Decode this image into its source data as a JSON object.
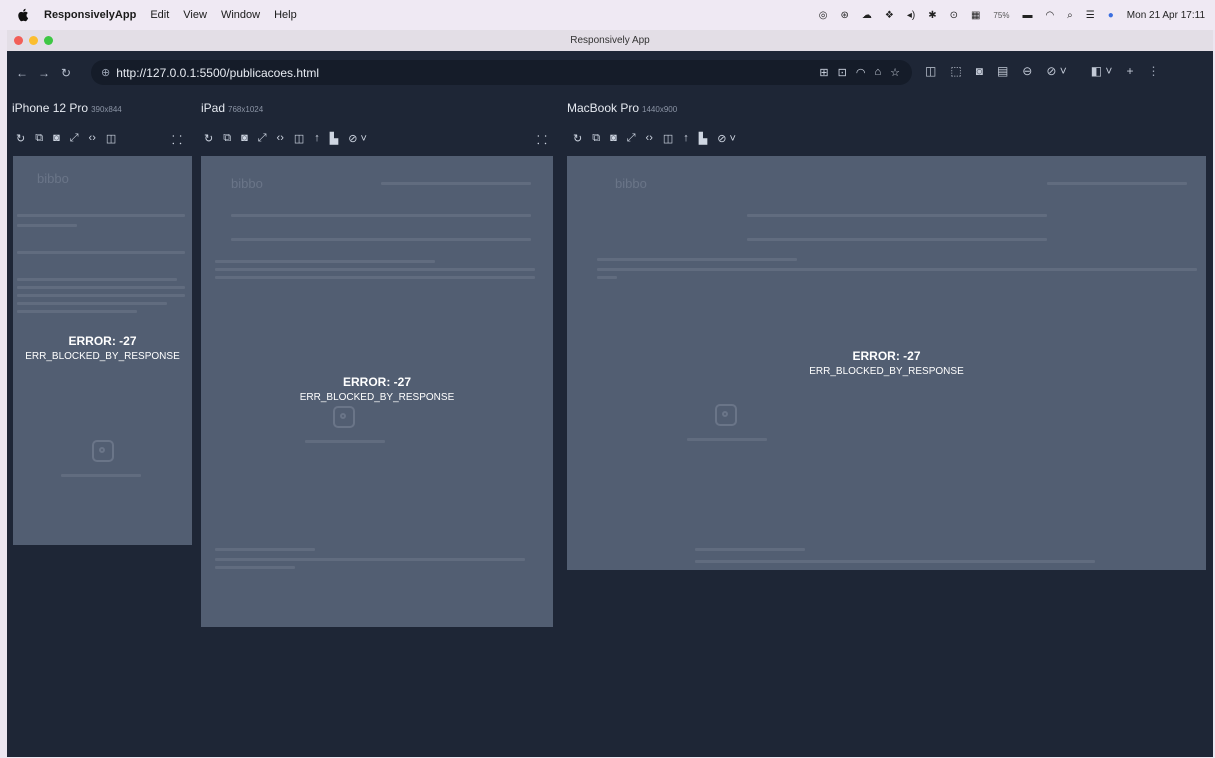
{
  "menubar": {
    "app_name": "ResponsivelyApp",
    "items": [
      "Edit",
      "View",
      "Window",
      "Help"
    ],
    "battery": "75%",
    "clock": "Mon 21 Apr  17:11"
  },
  "window": {
    "title": "Responsively App"
  },
  "address_bar": {
    "url": "http://127.0.0.1:5500/publicacoes.html"
  },
  "devices": [
    {
      "name": "iPhone 12 Pro",
      "resolution": "390x844",
      "error_code": "ERROR: -27",
      "error_message": "ERR_BLOCKED_BY_RESPONSE",
      "ghost_logo": "bibbo"
    },
    {
      "name": "iPad",
      "resolution": "768x1024",
      "error_code": "ERROR: -27",
      "error_message": "ERR_BLOCKED_BY_RESPONSE",
      "ghost_logo": "bibbo"
    },
    {
      "name": "MacBook Pro",
      "resolution": "1440x900",
      "error_code": "ERROR: -27",
      "error_message": "ERR_BLOCKED_BY_RESPONSE",
      "ghost_logo": "bibbo"
    }
  ],
  "colors": {
    "window_bg": "#1e2636",
    "frame_bg": "#525e72",
    "close": "#f25f58",
    "minimize": "#fbbe2f",
    "zoom": "#3ec744"
  }
}
